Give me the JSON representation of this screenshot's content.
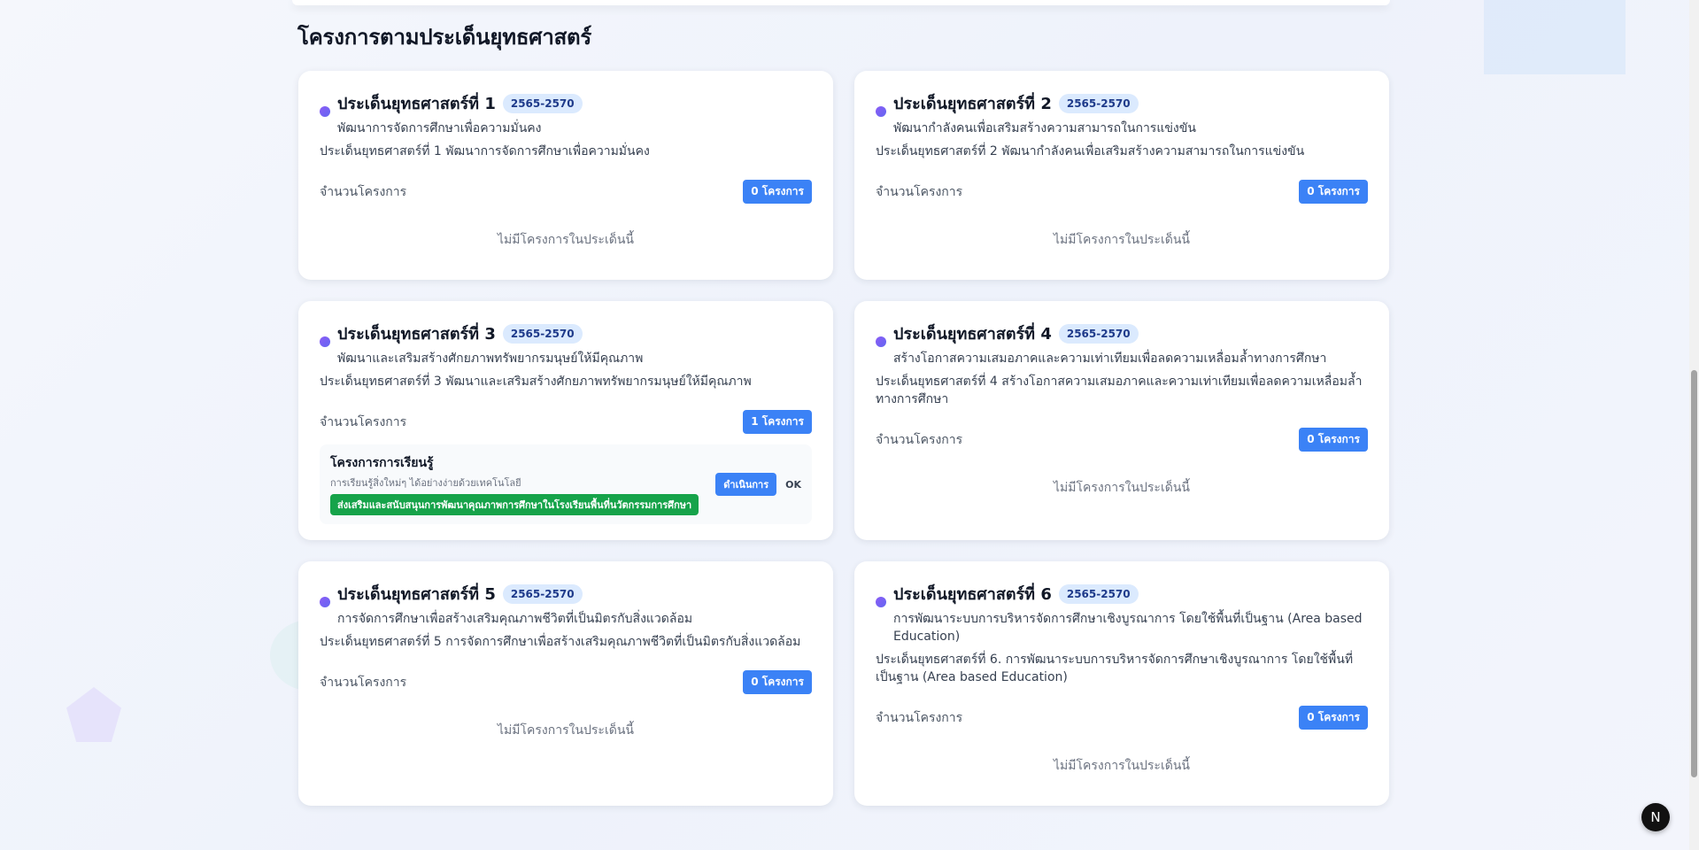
{
  "section": {
    "title": "โครงการตามประเด็นยุทธศาสตร์"
  },
  "common": {
    "count_label": "จำนวนโครงการ",
    "empty_text": "ไม่มีโครงการในประเด็นนี้"
  },
  "cards": [
    {
      "title": "ประเด็นยุทธศาสตร์ที่ 1",
      "year": "2565-2570",
      "subtitle": "พัฒนาการจัดการศึกษาเพื่อความมั่นคง",
      "description": "ประเด็นยุทธศาสตร์ที่ 1 พัฒนาการจัดการศึกษาเพื่อความมั่นคง",
      "count": "0 โครงการ"
    },
    {
      "title": "ประเด็นยุทธศาสตร์ที่ 2",
      "year": "2565-2570",
      "subtitle": "พัฒนากำลังคนเพื่อเสริมสร้างความสามารถในการแข่งขัน",
      "description": "ประเด็นยุทธศาสตร์ที่ 2 พัฒนากำลังคนเพื่อเสริมสร้างความสามารถในการแข่งขัน",
      "count": "0 โครงการ"
    },
    {
      "title": "ประเด็นยุทธศาสตร์ที่ 3",
      "year": "2565-2570",
      "subtitle": "พัฒนาและเสริมสร้างศักยภาพทรัพยากรมนุษย์ให้มีคุณภาพ",
      "description": "ประเด็นยุทธศาสตร์ที่ 3 พัฒนาและเสริมสร้างศักยภาพทรัพยากรมนุษย์ให้มีคุณภาพ",
      "count": "1 โครงการ",
      "project": {
        "name": "โครงการการเรียนรู้",
        "desc": "การเรียนรู้สิ่งใหม่ๆ ได้อย่างง่ายด้วยเทคโนโลยี",
        "tag": "ส่งเสริมและสนับสนุนการพัฒนาคุณภาพการศึกษาในโรงเรียนพื้นที่นวัตกรรมการศึกษา",
        "status": "ดำเนินการ",
        "ok": "OK"
      }
    },
    {
      "title": "ประเด็นยุทธศาสตร์ที่ 4",
      "year": "2565-2570",
      "subtitle": "สร้างโอกาสความเสมอภาคและความเท่าเทียมเพื่อลดความเหลื่อมล้ำทางการศึกษา",
      "description": "ประเด็นยุทธศาสตร์ที่ 4 สร้างโอกาสความเสมอภาคและความเท่าเทียมเพื่อลดความเหลื่อมล้ำทางการศึกษา",
      "count": "0 โครงการ"
    },
    {
      "title": "ประเด็นยุทธศาสตร์ที่ 5",
      "year": "2565-2570",
      "subtitle": "การจัดการศึกษาเพื่อสร้างเสริมคุณภาพชีวิตที่เป็นมิตรกับสิ่งแวดล้อม",
      "description": "ประเด็นยุทธศาสตร์ที่ 5 การจัดการศึกษาเพื่อสร้างเสริมคุณภาพชีวิตที่เป็นมิตรกับสิ่งแวดล้อม",
      "count": "0 โครงการ"
    },
    {
      "title": "ประเด็นยุทธศาสตร์ที่ 6",
      "year": "2565-2570",
      "subtitle": "การพัฒนาระบบการบริหารจัดการศึกษาเชิงบูรณาการ โดยใช้พื้นที่เป็นฐาน (Area based Education)",
      "description": "ประเด็นยุทธศาสตร์ที่ 6. การพัฒนาระบบการบริหารจัดการศึกษาเชิงบูรณาการ โดยใช้พื้นที่เป็นฐาน (Area based Education)",
      "count": "0 โครงการ"
    }
  ],
  "next_badge": {
    "label": "N"
  },
  "colors": {
    "accent": "#3b82f6",
    "year_badge_bg": "#dbeafe",
    "tag_green": "#16a34a",
    "dot_purple": "#8b5cf6"
  }
}
